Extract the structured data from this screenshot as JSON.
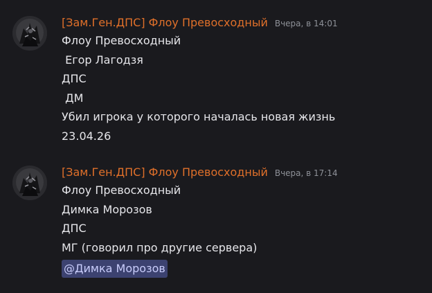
{
  "messages": [
    {
      "author": "[Зам.Ген.ДПС] Флоу Превосходный",
      "timestamp": "Вчера, в 14:01",
      "avatar_icon": "dark-character-avatar",
      "lines": [
        "Флоу Превосходный",
        " Егор Лагодзя",
        "ДПС",
        " ДМ",
        "Убил игрока у которого началась новая жизнь",
        "23.04.26"
      ]
    },
    {
      "author": "[Зам.Ген.ДПС] Флоу Превосходный",
      "timestamp": "Вчера, в 17:14",
      "avatar_icon": "dark-character-avatar",
      "lines": [
        "Флоу Превосходный",
        "Димка Морозов",
        "ДПС",
        "МГ (говорил про другие сервера)"
      ],
      "mention": "@Димка Морозов"
    }
  ],
  "colors": {
    "background": "#1a1a1e",
    "author": "#e0702a",
    "timestamp": "#8e9198",
    "text": "#e6e6ea",
    "mention_bg": "#3c4270",
    "mention_text": "#c9cdfb"
  }
}
